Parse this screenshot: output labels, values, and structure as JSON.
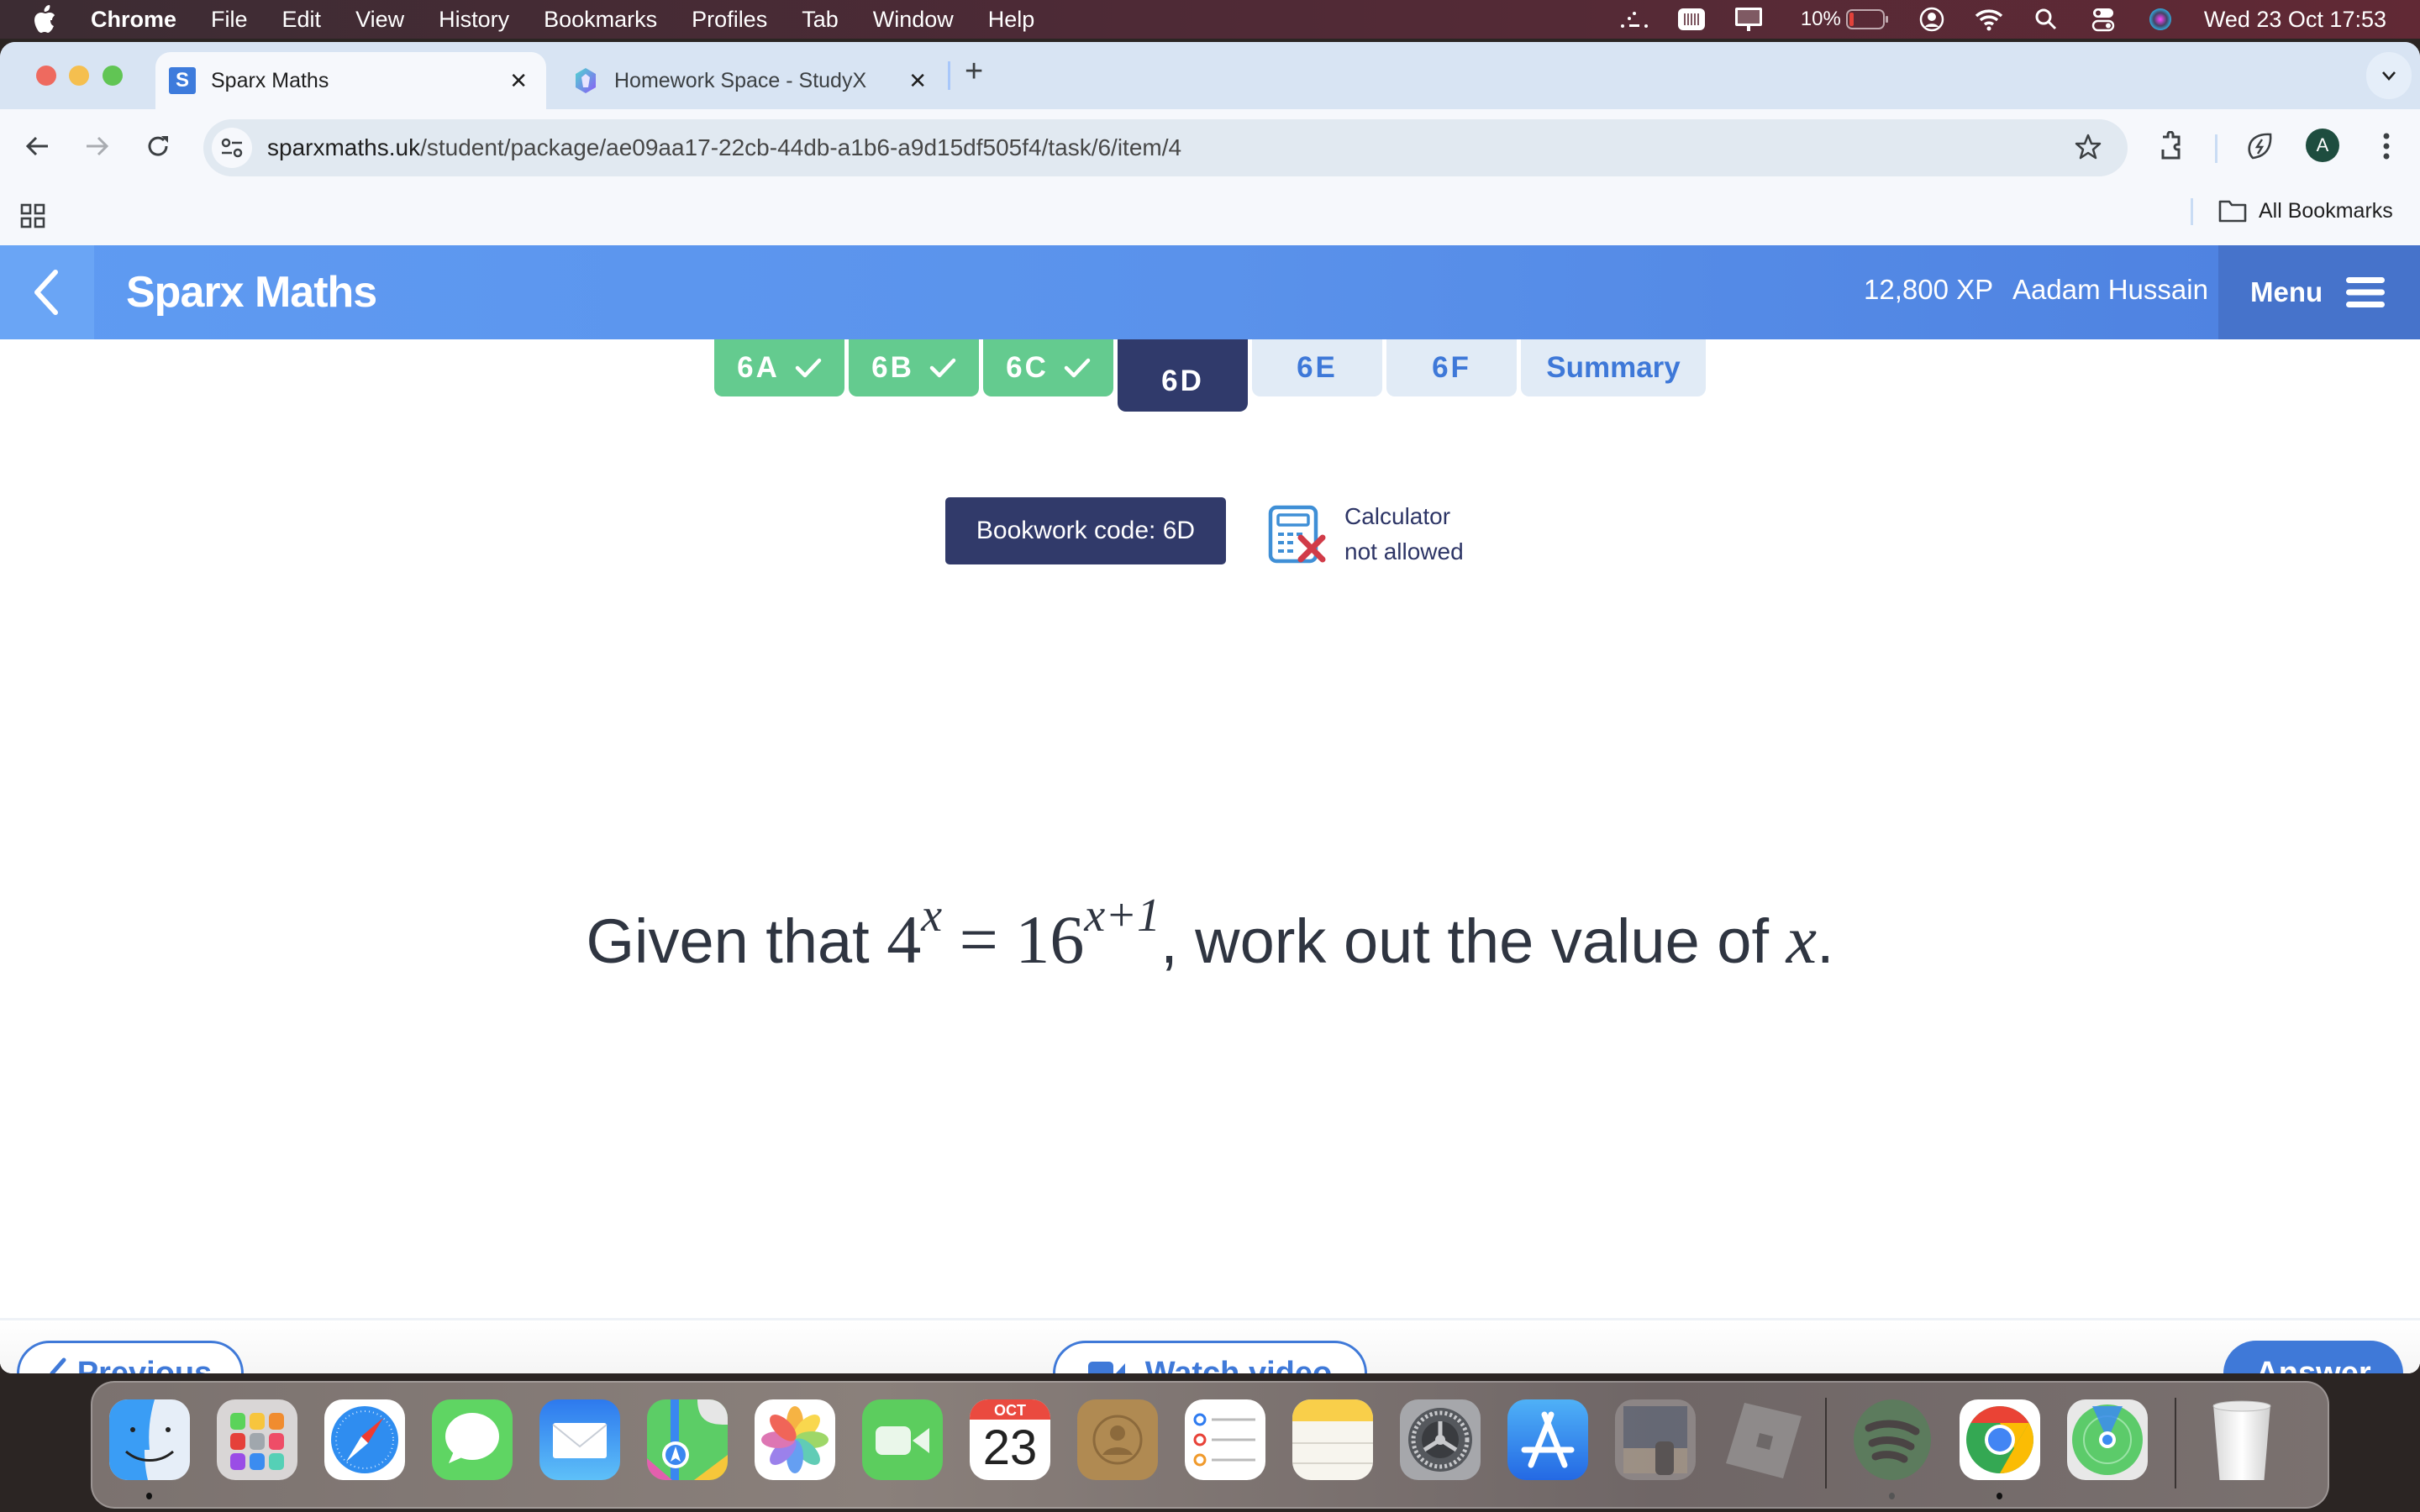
{
  "menubar": {
    "app_name": "Chrome",
    "menus": [
      "File",
      "Edit",
      "View",
      "History",
      "Bookmarks",
      "Profiles",
      "Tab",
      "Window",
      "Help"
    ],
    "battery_percent": "10%",
    "clock": "Wed 23 Oct  17:53",
    "status_icons": [
      "dots-icon",
      "keyboard-brightness-icon",
      "display-icon",
      "battery-icon",
      "user-icon",
      "wifi-icon",
      "spotlight-search-icon",
      "control-center-icon",
      "siri-icon"
    ]
  },
  "browser": {
    "tabs": [
      {
        "title": "Sparx Maths",
        "favicon": "S",
        "active": true
      },
      {
        "title": "Homework Space - StudyX",
        "active": false
      }
    ],
    "url_host": "sparxmaths.uk",
    "url_path": "/student/package/ae09aa17-22cb-44db-a1b6-a9d15df505f4/task/6/item/4",
    "profile_initial": "A",
    "all_bookmarks_label": "All Bookmarks"
  },
  "sparx": {
    "title": "Sparx Maths",
    "xp": "12,800 XP",
    "user_name": "Aadam Hussain",
    "menu_label": "Menu",
    "task_tabs": [
      {
        "label": "6A",
        "state": "done"
      },
      {
        "label": "6B",
        "state": "done"
      },
      {
        "label": "6C",
        "state": "done"
      },
      {
        "label": "6D",
        "state": "current"
      },
      {
        "label": "6E",
        "state": "todo"
      },
      {
        "label": "6F",
        "state": "todo"
      },
      {
        "label": "Summary",
        "state": "todo"
      }
    ],
    "bookwork_code": "Bookwork code: 6D",
    "calculator_line1": "Calculator",
    "calculator_line2": "not allowed",
    "question": {
      "prefix": "Given that ",
      "base1": "4",
      "exp1": "x",
      "equals": "=",
      "base2": "16",
      "exp2": "x+1",
      "middle": ", work out the value of ",
      "var": "x",
      "suffix": "."
    },
    "previous_label": "Previous",
    "watch_video_label": "Watch video",
    "answer_label": "Answer"
  },
  "colors": {
    "header_blue": "#5a92eb",
    "done_green": "#64cb8f",
    "current_navy": "#303a6b",
    "todo_bg": "#e1ebf6",
    "accent_blue": "#3f79d8",
    "calc_red": "#d13b48"
  },
  "dock": {
    "calendar_month": "OCT",
    "calendar_day": "23",
    "apps": [
      "Finder",
      "Launchpad",
      "Safari",
      "Messages",
      "Mail",
      "Maps",
      "Photos",
      "FaceTime",
      "Calendar",
      "Contacts",
      "Reminders",
      "Notes",
      "System Settings",
      "App Store",
      "Preview",
      "Roblox",
      "Spotify",
      "Google Chrome",
      "Find My",
      "Trash"
    ]
  }
}
